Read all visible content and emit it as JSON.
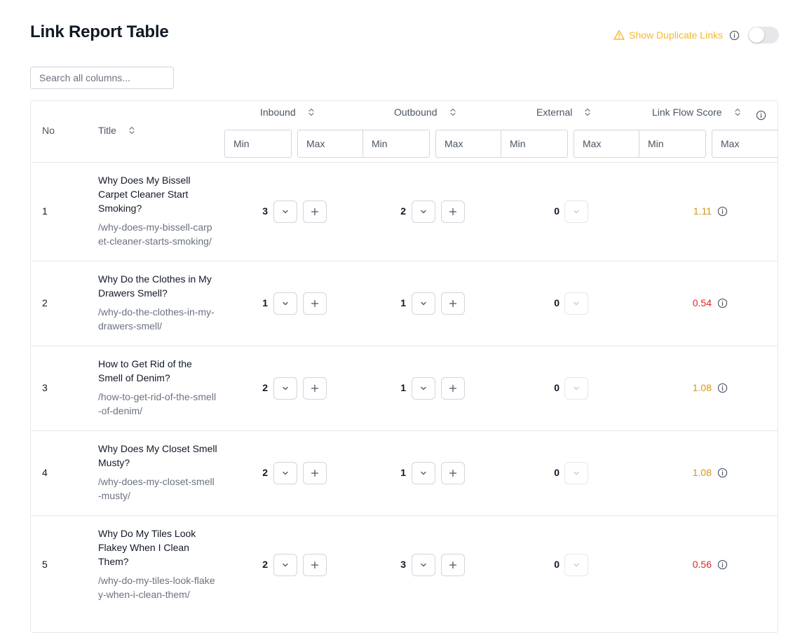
{
  "page": {
    "title": "Link Report Table"
  },
  "duplicate": {
    "label": "Show Duplicate Links",
    "enabled": false
  },
  "search": {
    "placeholder": "Search all columns..."
  },
  "columns": {
    "no": "No",
    "title": "Title",
    "inbound": "Inbound",
    "outbound": "Outbound",
    "external": "External",
    "score": "Link Flow Score"
  },
  "filters": {
    "min": "Min",
    "max": "Max"
  },
  "colors": {
    "score_ok": "#d99514",
    "score_low": "#dc2626",
    "warning": "#f5b82e"
  },
  "rows": [
    {
      "no": "1",
      "title": "Why Does My Bissell Carpet Cleaner Start Smoking?",
      "url": "/why-does-my-bissell-carpet-cleaner-starts-smoking/",
      "inbound": "3",
      "outbound": "2",
      "external": "0",
      "score": "1.11",
      "score_level": "ok"
    },
    {
      "no": "2",
      "title": "Why Do the Clothes in My Drawers Smell?",
      "url": "/why-do-the-clothes-in-my-drawers-smell/",
      "inbound": "1",
      "outbound": "1",
      "external": "0",
      "score": "0.54",
      "score_level": "low"
    },
    {
      "no": "3",
      "title": "How to Get Rid of the Smell of Denim?",
      "url": "/how-to-get-rid-of-the-smell-of-denim/",
      "inbound": "2",
      "outbound": "1",
      "external": "0",
      "score": "1.08",
      "score_level": "ok"
    },
    {
      "no": "4",
      "title": "Why Does My Closet Smell Musty?",
      "url": "/why-does-my-closet-smell-musty/",
      "inbound": "2",
      "outbound": "1",
      "external": "0",
      "score": "1.08",
      "score_level": "ok"
    },
    {
      "no": "5",
      "title": "Why Do My Tiles Look Flakey When I Clean Them?",
      "url": "/why-do-my-tiles-look-flakey-when-i-clean-them/",
      "inbound": "2",
      "outbound": "3",
      "external": "0",
      "score": "0.56",
      "score_level": "low"
    }
  ]
}
